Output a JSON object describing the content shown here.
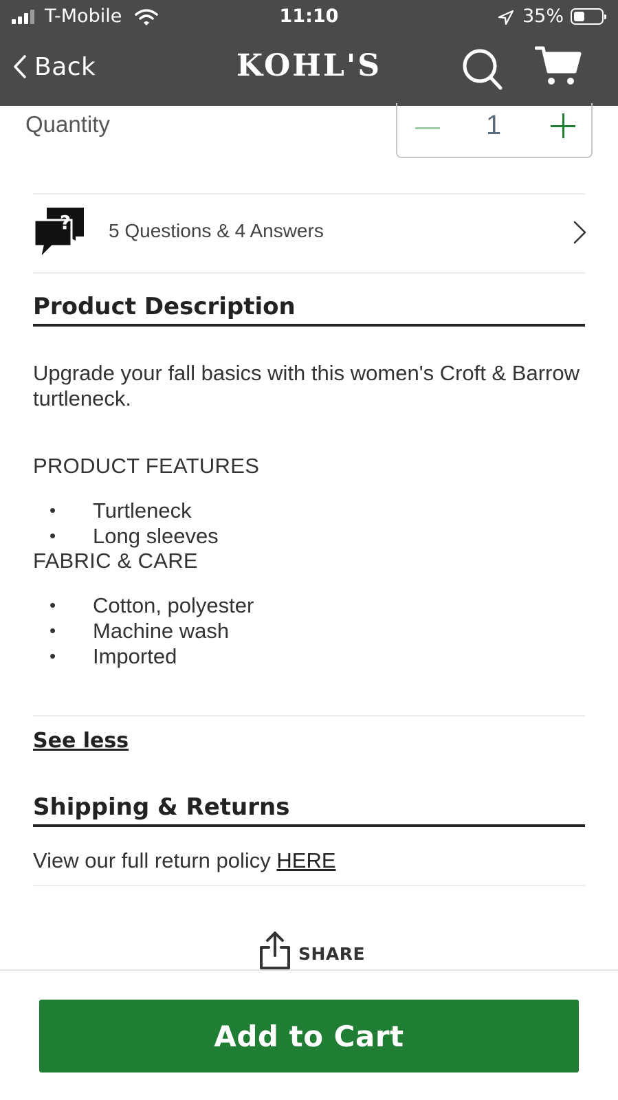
{
  "status_bar": {
    "carrier": "T-Mobile",
    "time": "11:10",
    "battery_pct": "35%"
  },
  "nav": {
    "back_label": "Back",
    "logo_text": "KOHL'S"
  },
  "quantity": {
    "label": "Quantity",
    "value": "1"
  },
  "qa": {
    "text": "5 Questions & 4 Answers"
  },
  "product_description": {
    "title": "Product Description",
    "intro": "Upgrade your fall basics with this women's Croft & Barrow turtleneck.",
    "features_heading": "PRODUCT FEATURES",
    "features": [
      "Turtleneck",
      "Long sleeves"
    ],
    "care_heading": "FABRIC & CARE",
    "care": [
      "Cotton, polyester",
      "Machine wash",
      "Imported"
    ],
    "see_less": "See less"
  },
  "shipping": {
    "title": "Shipping & Returns",
    "return_text": "View our full return policy ",
    "return_link": "HERE"
  },
  "share_label": "SHARE",
  "add_to_cart_label": "Add to Cart",
  "colors": {
    "header_bg": "#4a4a4a",
    "brand_green": "#1f7d34"
  }
}
